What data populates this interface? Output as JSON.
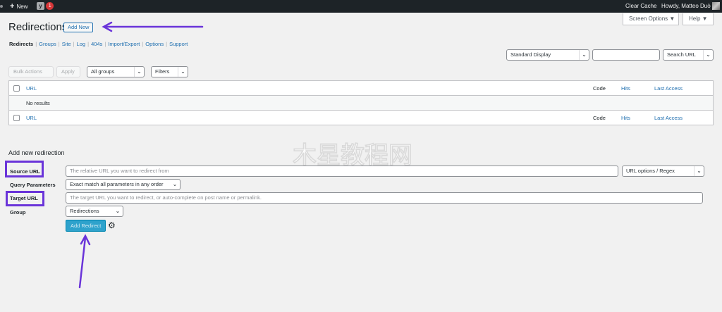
{
  "adminbar": {
    "new_label": "New",
    "yoast_letter": "y",
    "notifications": "1",
    "clear_cache": "Clear Cache",
    "howdy": "Howdy, Matteo Duò"
  },
  "top_buttons": {
    "screen_options": "Screen Options ▼",
    "help": "Help ▼"
  },
  "page": {
    "title": "Redirections",
    "add_new": "Add New"
  },
  "subnav": [
    {
      "label": "Redirects"
    },
    {
      "label": "Groups"
    },
    {
      "label": "Site"
    },
    {
      "label": "Log"
    },
    {
      "label": "404s"
    },
    {
      "label": "Import/Export"
    },
    {
      "label": "Options"
    },
    {
      "label": "Support"
    }
  ],
  "toolbar": {
    "display_select": "Standard Display",
    "search_value": "",
    "search_select": "Search URL",
    "bulk_actions": "Bulk Actions",
    "apply": "Apply",
    "groups_select": "All groups",
    "filters": "Filters"
  },
  "table": {
    "columns": {
      "url": "URL",
      "code": "Code",
      "hits": "Hits",
      "last_access": "Last Access"
    },
    "empty_text": "No results"
  },
  "form": {
    "heading": "Add new redirection",
    "source_label": "Source URL",
    "source_placeholder": "The relative URL you want to redirect from",
    "url_options": "URL options / Regex",
    "query_label": "Query Parameters",
    "query_value": "Exact match all parameters in any order",
    "target_label": "Target URL",
    "target_placeholder": "The target URL you want to redirect, or auto-complete on post name or permalink.",
    "group_label": "Group",
    "group_value": "Redirections",
    "submit": "Add Redirect"
  },
  "watermark": "木星教程网",
  "colors": {
    "annotation": "#6a34d9",
    "link": "#2271b1",
    "primary": "#2ea2cc",
    "adminbar": "#1d2327"
  },
  "icons": [
    "plus-icon",
    "yoast-icon",
    "chevron-down-icon",
    "gear-icon",
    "checkbox-icon",
    "arrow-annotation-icon"
  ]
}
